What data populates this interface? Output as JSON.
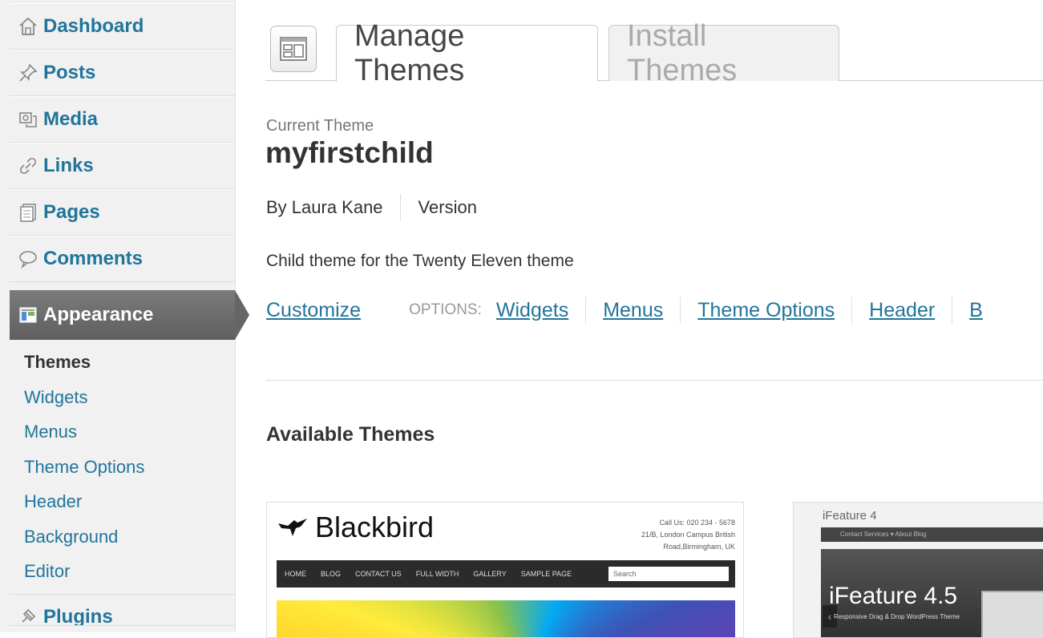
{
  "sidebar": {
    "items": [
      {
        "label": "Dashboard",
        "icon": "dashboard-icon"
      },
      {
        "label": "Posts",
        "icon": "pushpin-icon"
      },
      {
        "label": "Media",
        "icon": "media-icon"
      },
      {
        "label": "Links",
        "icon": "link-icon"
      },
      {
        "label": "Pages",
        "icon": "pages-icon"
      },
      {
        "label": "Comments",
        "icon": "comment-bubble-icon"
      }
    ],
    "appearance": {
      "label": "Appearance",
      "icon": "appearance-icon"
    },
    "submenu": [
      "Themes",
      "Widgets",
      "Menus",
      "Theme Options",
      "Header",
      "Background",
      "Editor"
    ],
    "plugins": {
      "label": "Plugins",
      "icon": "plug-icon"
    }
  },
  "tabs": {
    "manage": "Manage Themes",
    "install": "Install Themes"
  },
  "current_theme": {
    "label": "Current Theme",
    "name": "myfirstchild",
    "author": "By Laura Kane",
    "version": "Version",
    "description": "Child theme for the Twenty Eleven theme",
    "customize": "Customize",
    "options_label": "OPTIONS:",
    "options": [
      "Widgets",
      "Menus",
      "Theme Options",
      "Header",
      "B"
    ]
  },
  "available": {
    "heading": "Available Themes",
    "themes": [
      {
        "logo": "Blackbird",
        "contact": [
          "Call Us: 020 234 - 5678",
          "21/B, London Campus British",
          "Road,Birmingham, UK"
        ],
        "nav": [
          "HOME",
          "BLOG",
          "CONTACT US",
          "FULL WIDTH",
          "GALLERY",
          "SAMPLE PAGE"
        ],
        "search": "Search"
      },
      {
        "title": "iFeature 4",
        "nav": "Contact   Services ▾   About   Blog",
        "headline": "iFeature 4.5",
        "tagline": "Responsive Drag & Drop WordPress Theme"
      }
    ]
  },
  "colors": {
    "link": "#21759b",
    "sidebar_bg": "#f1f1f1",
    "active_menu": "#6d6d6d"
  }
}
